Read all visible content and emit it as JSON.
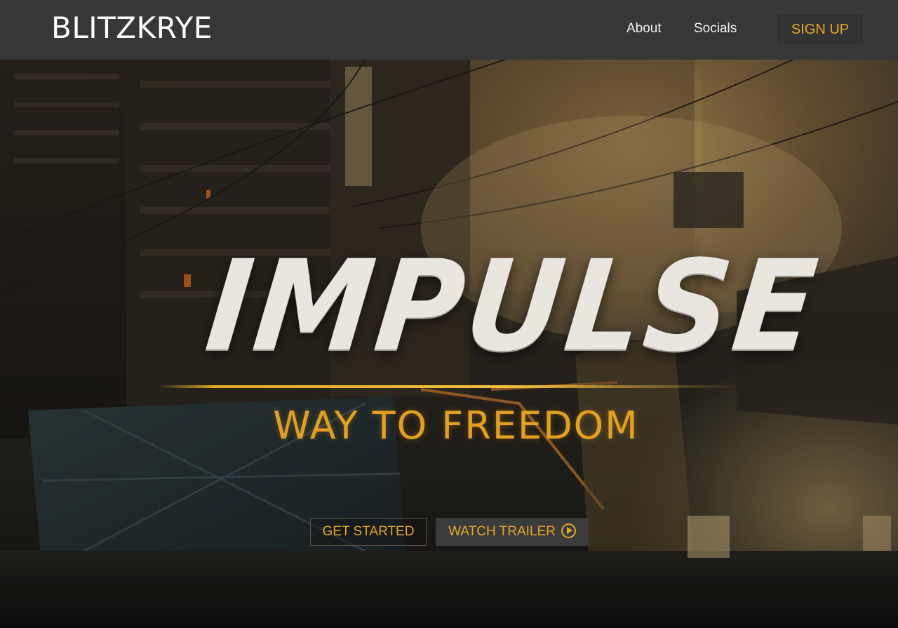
{
  "navbar": {
    "brand": "BLITZKRYE",
    "links": [
      "About",
      "Socials"
    ],
    "signup_label": "SIGN UP"
  },
  "hero": {
    "title": "IMPULSE",
    "tagline": "WAY TO FREEDOM",
    "get_started_label": "GET STARTED",
    "watch_trailer_label": "WATCH TRAILER",
    "play_icon": "play-circle-icon"
  },
  "colors": {
    "navbar_bg": "#373737",
    "accent": "#e3a928",
    "title": "#e9e6df",
    "trailer_button_bg": "#3b3b3b"
  }
}
